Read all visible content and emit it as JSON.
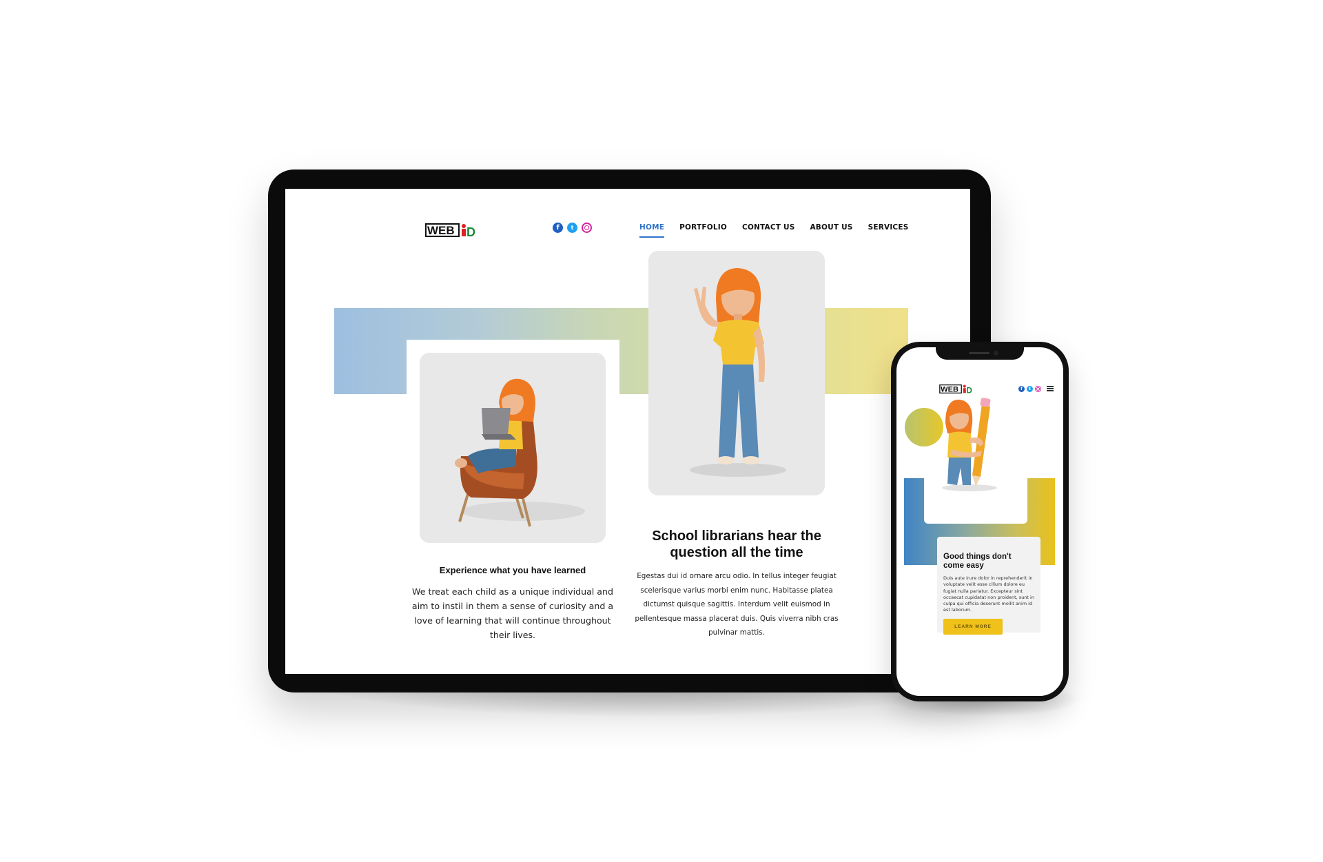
{
  "logo": {
    "text": "WEBiD"
  },
  "tablet": {
    "nav": [
      "HOME",
      "PORTFOLIO",
      "CONTACT US",
      "ABOUT US",
      "SERVICES"
    ],
    "active_nav": "HOME",
    "social": [
      "facebook-icon",
      "twitter-icon",
      "instagram-icon"
    ],
    "feature_left": {
      "heading": "Experience what you have learned",
      "body": "We treat each child as a unique individual and aim to instil in them a sense of curiosity and a love of learning that will continue throughout their lives."
    },
    "feature_right": {
      "heading": "School librarians hear the question all the time",
      "body": "Egestas dui id ornare arcu odio. In tellus integer feugiat scelerisque varius morbi enim nunc. Habitasse platea dictumst quisque sagittis. Interdum velit euismod in pellentesque massa placerat duis. Quis viverra nibh cras pulvinar mattis."
    }
  },
  "phone": {
    "heading": "Good things don't come easy",
    "body": "Duis aute irure dolor in reprehenderit in voluptate velit esse cillum dolore eu fugiat nulla pariatur. Excepteur sint occaecat cupidatat non proident, sunt in culpa qui officia deserunt mollit anim id est laborum.",
    "button": "LEARN MORE"
  },
  "colors": {
    "accent_blue": "#2f73c9",
    "button_yellow": "#efc11a",
    "hair_orange": "#f07a22",
    "shirt_yellow": "#f4c332"
  }
}
